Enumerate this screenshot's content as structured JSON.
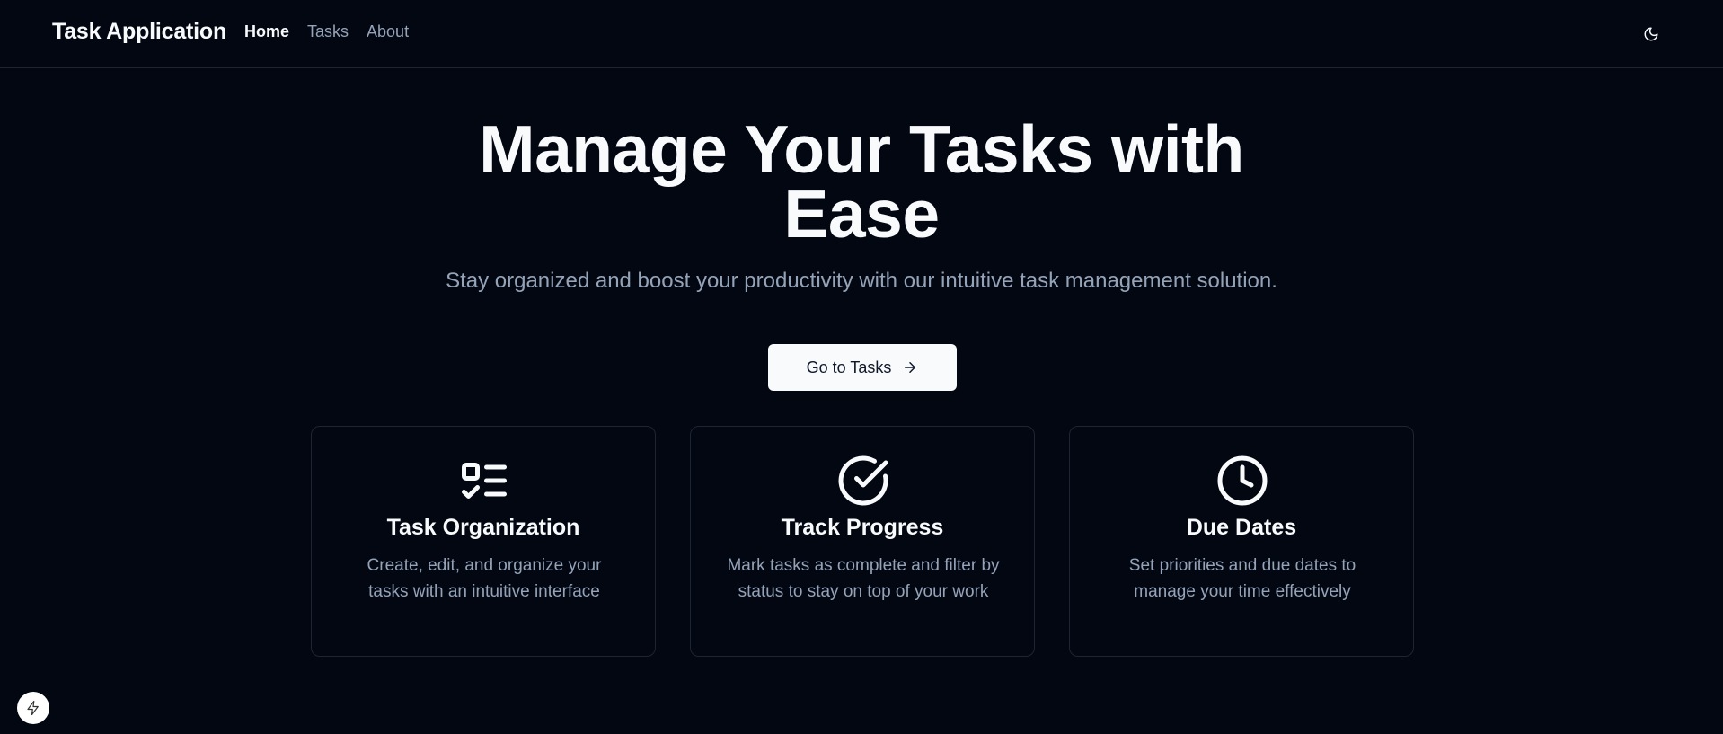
{
  "navbar": {
    "brand": "Task Application",
    "links": [
      {
        "label": "Home",
        "active": true
      },
      {
        "label": "Tasks",
        "active": false
      },
      {
        "label": "About",
        "active": false
      }
    ],
    "theme_toggle_icon": "moon-icon"
  },
  "hero": {
    "title": "Manage Your Tasks with Ease",
    "subtitle": "Stay organized and boost your productivity with our intuitive task management solution.",
    "cta_label": "Go to Tasks",
    "cta_icon": "arrow-right-icon"
  },
  "features": [
    {
      "icon": "list-checks-icon",
      "title": "Task Organization",
      "description": "Create, edit, and organize your tasks with an intuitive interface"
    },
    {
      "icon": "circle-check-icon",
      "title": "Track Progress",
      "description": "Mark tasks as complete and filter by status to stay on top of your work"
    },
    {
      "icon": "clock-icon",
      "title": "Due Dates",
      "description": "Set priorities and due dates to manage your time effectively"
    }
  ],
  "dev_badge_icon": "lightning-icon",
  "colors": {
    "background": "#030712",
    "text_primary": "#f8fafc",
    "text_muted": "#94a3b8",
    "border": "#1e2433",
    "button_bg": "#f8fafc",
    "button_text": "#0f172a"
  }
}
